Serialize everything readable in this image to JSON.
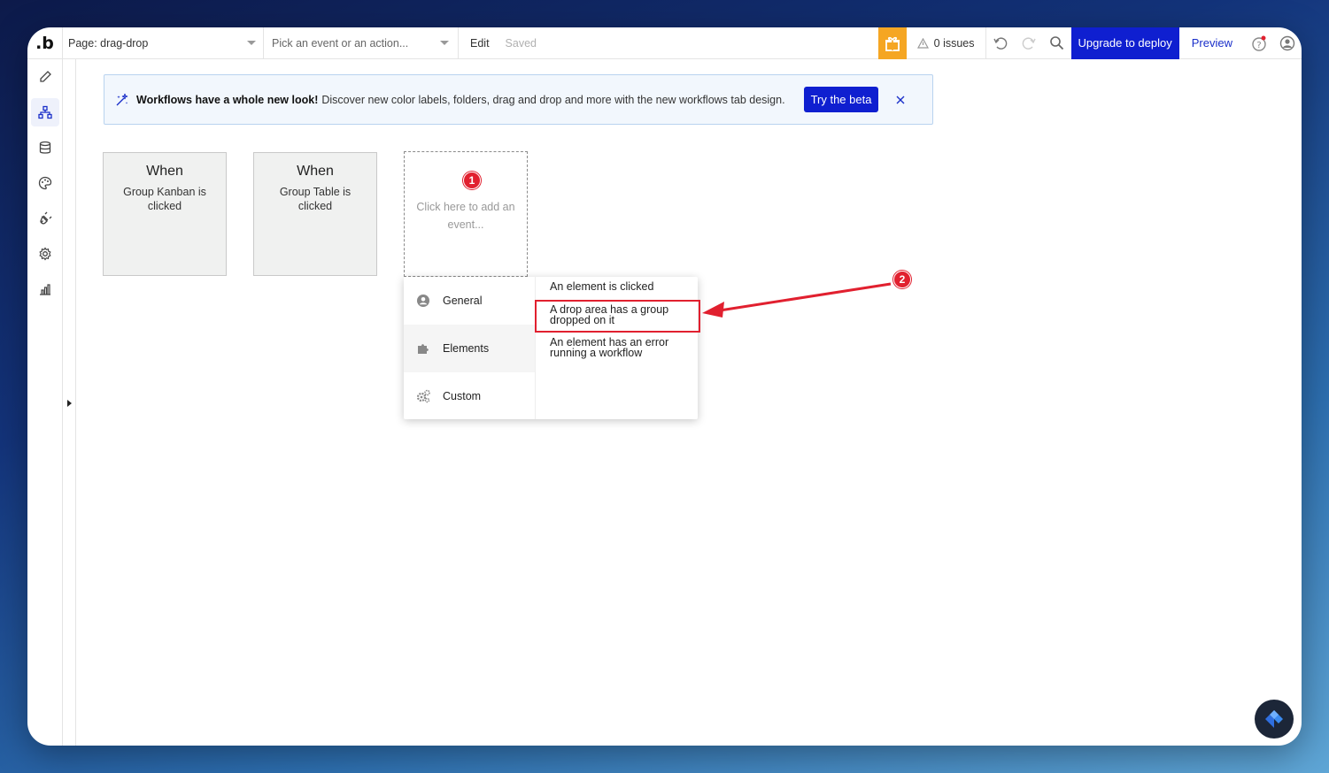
{
  "topbar": {
    "logo": ".b",
    "page_select": "Page: drag-drop",
    "event_select_placeholder": "Pick an event or an action...",
    "edit_label": "Edit",
    "saved_label": "Saved",
    "issues": "0 issues",
    "upgrade_button": "Upgrade to deploy",
    "preview_link": "Preview"
  },
  "banner": {
    "title": "Workflows have a whole new look!",
    "description": "Discover new color labels, folders, drag and drop and more with the new workflows tab design.",
    "beta_button": "Try the beta"
  },
  "events": [
    {
      "when": "When",
      "description": "Group Kanban is clicked"
    },
    {
      "when": "When",
      "description": "Group Table is clicked"
    }
  ],
  "add_event": {
    "badge": "1",
    "text": "Click here to add an event..."
  },
  "menu": {
    "categories": [
      "General",
      "Elements",
      "Custom"
    ],
    "options": [
      "An element is clicked",
      "A drop area has a group dropped on it",
      "An element has an error running a workflow"
    ]
  },
  "annotation": {
    "badge": "2"
  },
  "colors": {
    "accent": "#0f1fd0",
    "gift": "#f5a623",
    "annotation_red": "#e1202f"
  },
  "icons": {
    "rail": [
      "pencil-icon",
      "workflow-icon",
      "database-icon",
      "palette-icon",
      "plugin-icon",
      "settings-icon",
      "chart-icon"
    ]
  }
}
